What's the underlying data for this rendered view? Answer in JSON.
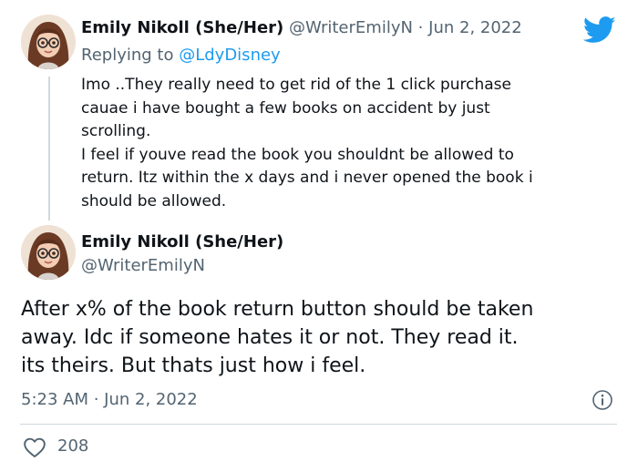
{
  "reply_tweet": {
    "display_name": "Emily Nikoll (She/Her)",
    "handle": "@WriterEmilyN",
    "separator": "·",
    "date": "Jun 2, 2022",
    "replying_prefix": "Replying to",
    "replying_handle": "@LdyDisney",
    "lines": [
      "Imo ..They really need to get rid of the 1 click purchase",
      "cauae i have bought a few books on accident by just",
      "scrolling.",
      "I feel if youve read the book you shouldnt be allowed to",
      "return. Itz within the x days and i never opened the book i",
      "should be allowed."
    ]
  },
  "main_tweet": {
    "display_name": "Emily Nikoll (She/Her)",
    "handle": "@WriterEmilyN",
    "lines": [
      "After x% of the book return button should be taken",
      "away. Idc if someone hates it or not. They read it.",
      "its theirs. But thats just how i feel."
    ],
    "timestamp": "5:23 AM · Jun 2, 2022",
    "likes": "208"
  },
  "icons": {
    "brand": "twitter-bird-icon",
    "info": "info-icon",
    "like": "heart-icon"
  },
  "colors": {
    "brand_blue": "#1d9bf0",
    "text": "#0f1419",
    "muted": "#536471",
    "divider": "#cfd9de"
  }
}
